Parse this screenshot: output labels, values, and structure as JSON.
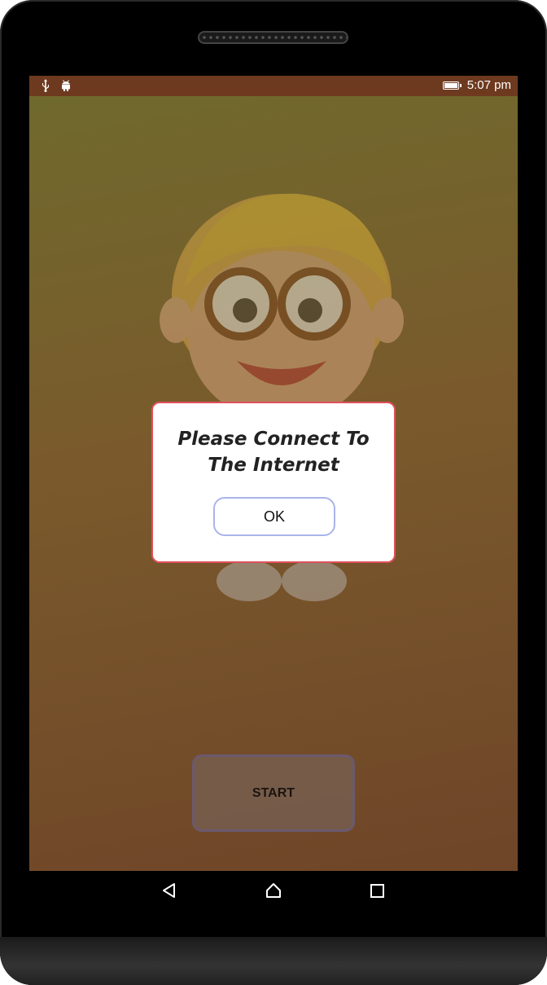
{
  "status_bar": {
    "time": "5:07 pm",
    "icons": [
      "usb-icon",
      "android-debug-icon",
      "battery-icon"
    ],
    "background_color": "#6e3a1f"
  },
  "dialog": {
    "message_line1": "Please Connect To",
    "message_line2": "The Internet",
    "ok_label": "OK",
    "border_color": "#e0505a"
  },
  "main": {
    "start_label": "START",
    "illustration": "cartoon-boy-with-glasses"
  },
  "nav_bar": {
    "icons": [
      "back-icon",
      "home-icon",
      "recents-icon"
    ]
  }
}
